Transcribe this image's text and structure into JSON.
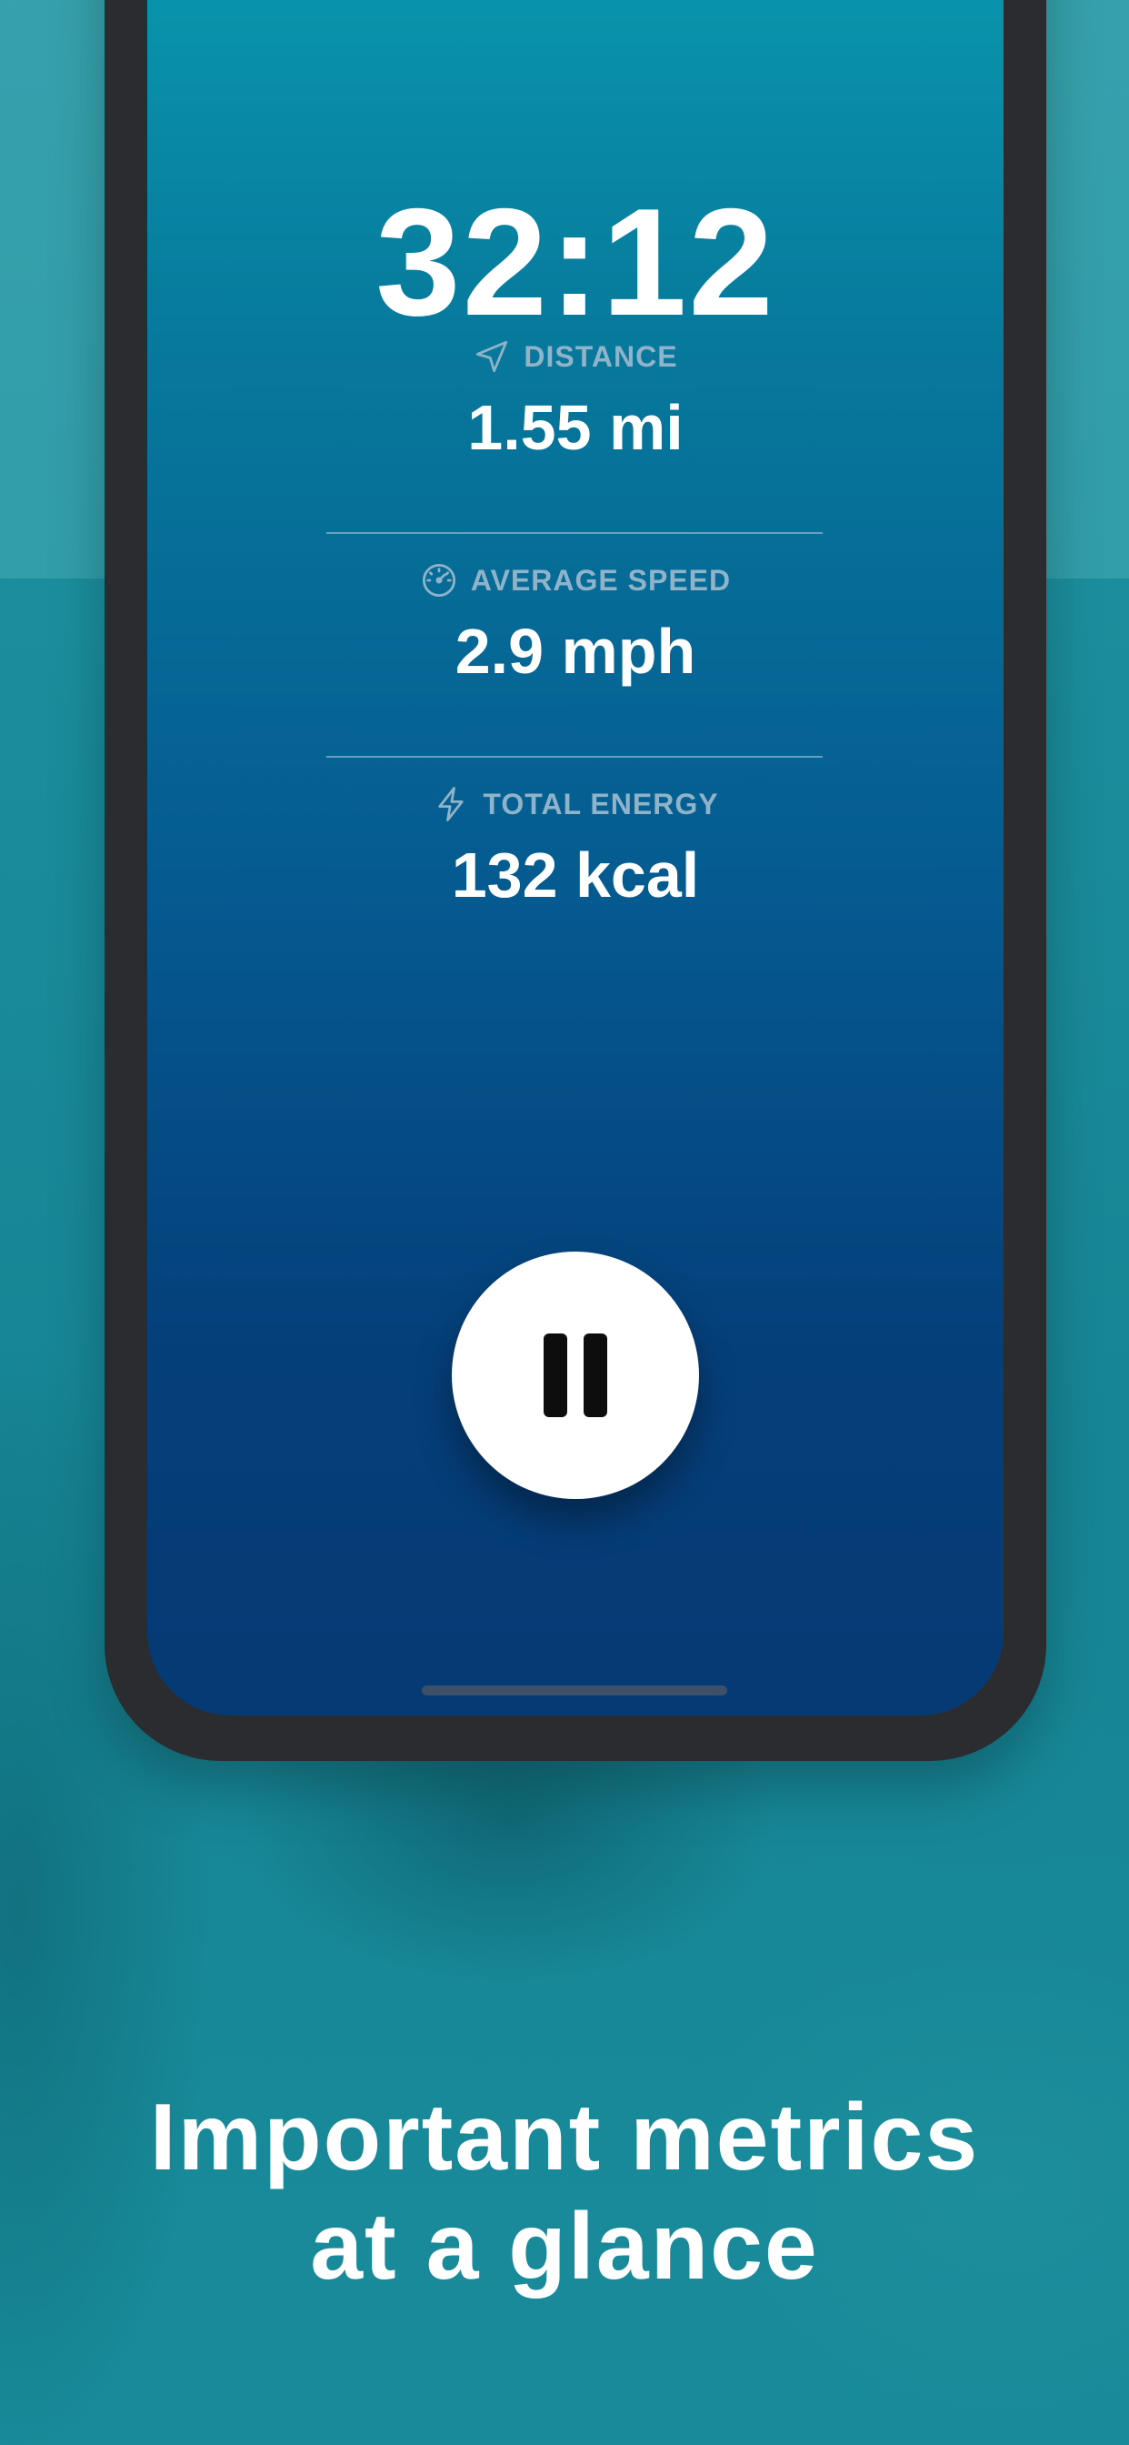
{
  "workout": {
    "timer": "32:12",
    "metrics": [
      {
        "icon": "location-arrow-icon",
        "label": "DISTANCE",
        "value": "1.55 mi"
      },
      {
        "icon": "speedometer-icon",
        "label": "AVERAGE SPEED",
        "value": "2.9 mph"
      },
      {
        "icon": "lightning-icon",
        "label": "TOTAL ENERGY",
        "value": "132 kcal"
      }
    ],
    "pause_icon": "pause-icon"
  },
  "caption": {
    "line1": "Important metrics",
    "line2": "at a glance"
  },
  "colors": {
    "background": "#1a8a9a",
    "screen_top": "#0a9bb0",
    "screen_bottom": "#053a74",
    "label": "#8fb3c8",
    "text": "#ffffff"
  }
}
